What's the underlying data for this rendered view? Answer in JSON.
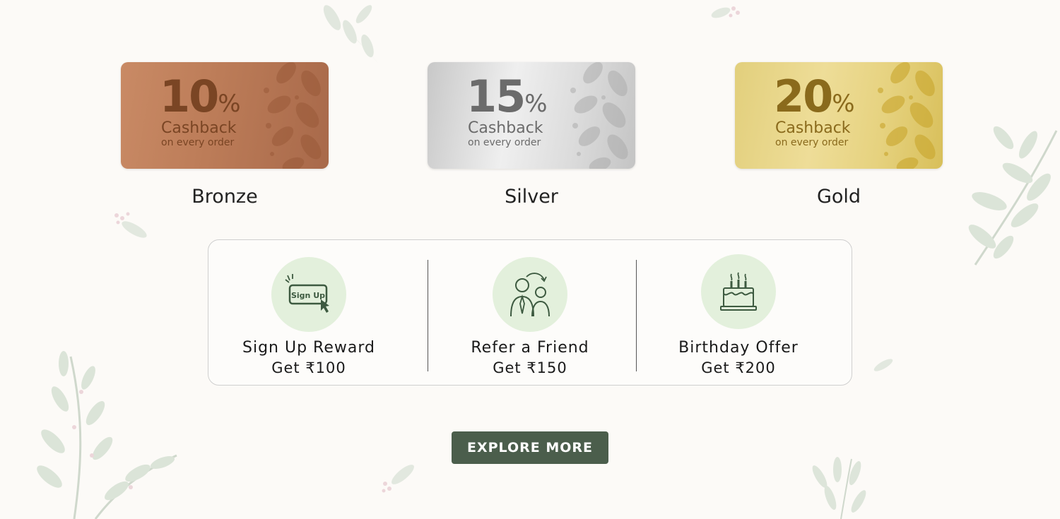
{
  "tiers": [
    {
      "id": "bronze",
      "percent": "10",
      "percent_sign": "%",
      "cashback_label": "Cashback",
      "cashback_sub": "on every order",
      "name": "Bronze"
    },
    {
      "id": "silver",
      "percent": "15",
      "percent_sign": "%",
      "cashback_label": "Cashback",
      "cashback_sub": "on every order",
      "name": "Silver"
    },
    {
      "id": "gold",
      "percent": "20",
      "percent_sign": "%",
      "cashback_label": "Cashback",
      "cashback_sub": "on every order",
      "name": "Gold"
    }
  ],
  "rewards": [
    {
      "title": "Sign Up Reward",
      "value": "Get ₹100",
      "icon": "sign-up-icon",
      "icon_text": "Sign Up"
    },
    {
      "title": "Refer a Friend",
      "value": "Get ₹150",
      "icon": "refer-friend-icon"
    },
    {
      "title": "Birthday Offer",
      "value": "Get ₹200",
      "icon": "birthday-cake-icon"
    }
  ],
  "cta": {
    "label": "EXPLORE MORE"
  },
  "colors": {
    "background": "#fcfaf7",
    "button": "#4b5e4c",
    "icon_circle": "#e3f0dc",
    "icon_stroke": "#3d5a40"
  }
}
